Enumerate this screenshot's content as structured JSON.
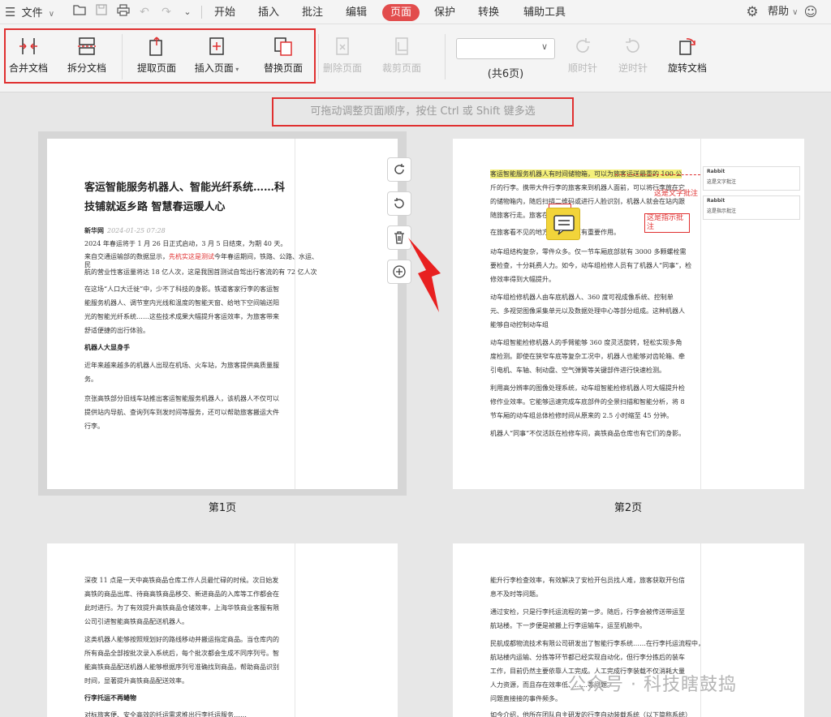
{
  "menubar": {
    "file_label": "文件",
    "tabs": [
      {
        "label": "开始"
      },
      {
        "label": "插入"
      },
      {
        "label": "批注"
      },
      {
        "label": "编辑"
      },
      {
        "label": "页面"
      },
      {
        "label": "保护"
      },
      {
        "label": "转换"
      },
      {
        "label": "辅助工具"
      }
    ],
    "help_label": "帮助",
    "accent_color": "#e24c4c"
  },
  "ribbon": {
    "merge": "合并文档",
    "split": "拆分文档",
    "extract": "提取页面",
    "insert": "插入页面",
    "replace": "替换页面",
    "delete": "删除页面",
    "crop": "裁剪页面",
    "page_count": "(共6页)",
    "rotate_cw": "顺时针",
    "rotate_ccw": "逆时针",
    "rotate_doc": "旋转文档"
  },
  "hint": "可拖动调整页面顺序，按住 Ctrl 或 Shift 键多选",
  "pages": {
    "p1_label": "第1页",
    "p2_label": "第2页",
    "p1": {
      "title1": "客运智能服务机器人、智能光纤系统……科",
      "title2": "技铺就返乡路 智慧春运暖人心",
      "source": "新华网",
      "date": "2024-01-25 07:28",
      "l1": "2024 年春运将于 1 月 26 日正式启动，3 月 5 日结束，为期 40 天。",
      "l2a": "来自交通运输部的数据显示，",
      "l2b": "先杭实这是测试",
      "l2c": "今年春运期间，铁路、公路、水运、",
      "l3": "民",
      "l4": "航的营业性客运量将达 18 亿人次，这是我国首测试自驾出行客流的有 72 亿人次",
      "l5": "在这场“人口大迁徙”中，少不了科技的身影。铁道客家行李的客运智",
      "l6": "能服务机器人、调节室内光线和温度的智能天窗、给地下空间输送阳",
      "l7": "光的智能光纤系统……这些技术成果大幅提升客运效率，为旅客带来",
      "l8": "舒适便捷的出行体验。",
      "h1": "机器人大显身手",
      "l9": "近年来越来越多的机器人出现在机场、火车站，为旅客提供高质量服",
      "l10": "务。",
      "l11": "京张高铁部分旧线车站推出客运智能服务机器人，该机器人不仅可以",
      "l12": "提供站内导航、查询列车到发时间等服务，还可以帮助旅客搬运大件",
      "l13": "行李。"
    },
    "p2": {
      "l1": "客运智能服务机器人有时间储物箱，可以为旅客运送最重的 100 公",
      "l2": "斤的行李。携带大件行李的旅客来到机器人面前，可以将行李放在它",
      "l3": "的储物箱内，随后扫描二维码或进行人脸识别，机器人就会在站内跟",
      "l4": "随旅客行走。旅客在站内……",
      "l5": "在旅客看不见的地方……安全更有重要作用。",
      "l6": "动车组结构复杂，零件众多。仅一节车厢底部就有 3000 多颗螺栓需",
      "l7": "要检查，十分耗费人力。如今，动车组检修人员有了机器人“同事”，检",
      "l8": "修效率得到大幅提升。",
      "l9": "动车组检修机器人由车底机器人、360 度可视成像系统、控制单",
      "l10": "元、多视觉图像采集单元以及数据处理中心等部分组成。这种机器人",
      "l11": "能够自动控制动车组",
      "l12": "动车组智能检修机器人的手臂能够 360 度灵活旋转，轻松实现多角",
      "l13": "度检测。即使在狭窄车底等复杂工况中，机器人也能够对齿轮箱、牵",
      "l14": "引电机、车轴、制动盘、空气弹簧等关键部件进行快速检测。",
      "l15": "利用高分辨率的图像处理系统，动车组智能检修机器人可大幅提升检",
      "l16": "修作业效率。它能够迅速完成车底部件的全景扫描和智能分析，将 8",
      "l17": "节车厢的动车组总体检修时间从原来的 2.5 小时缩至 45 分钟。",
      "l18": "机器人“同事”不仅活跃在检修车间，高铁商品仓库也有它们的身影。",
      "anno1": "这是文字批注",
      "anno2": "这是指示批注",
      "c_author1": "Rabbit",
      "c_text1": "这是文字批注",
      "c_author2": "Rabbit",
      "c_text2": "这是指示批注"
    },
    "p3": {
      "l1": "深夜 11 点是一天中高铁商品仓库工作人员最忙碌的时候。次日始发",
      "l2": "高铁的商品出库、待商高铁商品移交、新进商品的入库等工作都会在",
      "l3": "此时进行。为了有效提升高铁商品仓储效率，上海华铁商业客服有限",
      "l4": "公司引进智能高铁商品配送机器人。",
      "l5": "这类机器人能够按照规划好的路线移动并搬运指定商品。当仓库内的",
      "l6": "所有商品全部按批次录入系统后，每个批次都会生成不同序列号。智",
      "l7": "能高铁商品配送机器人能够根据序列号准确找到商品，帮助商品识别",
      "l8": "时间，显著提升高铁商品配送效率。",
      "h1": "行李托运不再蜷物",
      "l9": "对标旅客便、安全高效的托运需求推出行李托运服务……"
    },
    "p4": {
      "l1": "能升行李检查效率，有效解决了安检开包员找人难，旅客获取开包信",
      "l2": "息不及时等问题。",
      "l3": "通过安检，只是行李托运流程的第一步。随后，行李会被传送带运至",
      "l4": "航站楼。下一步便是被搬上行李运输车，运至机舱中。",
      "l5": "民航成都物流技术有限公司研发出了智能行李系统……在行李托运流程中，",
      "l6": "航站楼内运输、分拣等环节都已经实现自动化，但行李分拣后的装车",
      "l7": "工作，目前仍然主要依靠人工完成。人工完成行李装载不仅消耗大量",
      "l8": "人力资源，而且存在效率低、……等问题。",
      "l9": "问题直接接的事件频多。",
      "l10": "如今介绍，他所在团队自主研发的行李自动装载系统（以下简称系统）"
    }
  },
  "watermark": "公众号 · 科技瞎鼓捣"
}
